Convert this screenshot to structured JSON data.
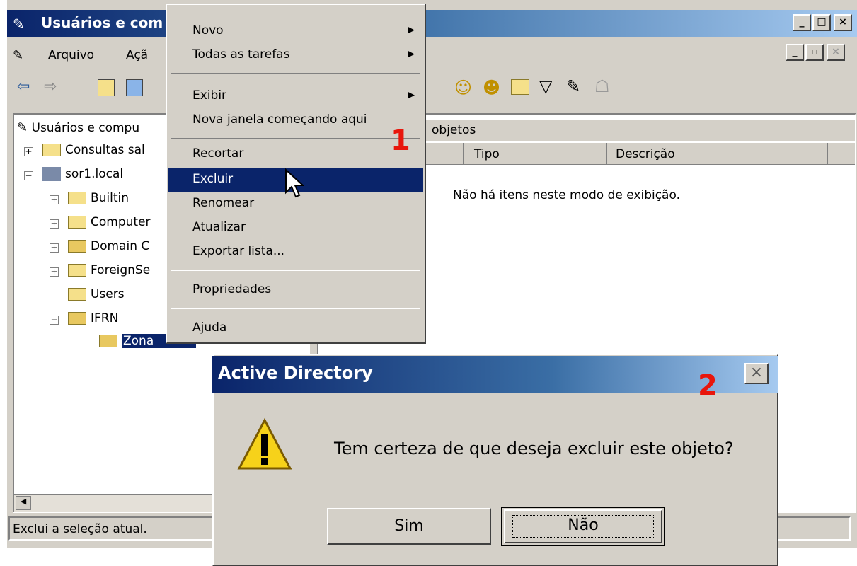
{
  "window": {
    "title": "Usuários e com"
  },
  "menubar": {
    "items": [
      "Arquivo",
      "Açã"
    ]
  },
  "tree": {
    "root": "Usuários e compu",
    "items": [
      "Consultas sal",
      "sor1.local",
      "Builtin",
      "Computer",
      "Domain C",
      "ForeignSe",
      "Users",
      "IFRN",
      "Zona"
    ]
  },
  "right_pane": {
    "header_text": "objetos",
    "columns": [
      "Tipo",
      "Descrição"
    ],
    "empty_message": "Não há itens neste modo de exibição."
  },
  "context_menu": {
    "items": {
      "novo": "Novo",
      "todas": "Todas as tarefas",
      "exibir": "Exibir",
      "nova_janela": "Nova janela começando aqui",
      "recortar": "Recortar",
      "excluir": "Excluir",
      "renomear": "Renomear",
      "atualizar": "Atualizar",
      "exportar": "Exportar lista...",
      "propriedades": "Propriedades",
      "ajuda": "Ajuda"
    },
    "highlighted": "Excluir"
  },
  "status_bar": {
    "text": "Exclui a seleção atual."
  },
  "dialog": {
    "title": "Active Directory",
    "message": "Tem certeza de que deseja excluir este objeto?",
    "yes_label": "Sim",
    "no_label": "Não",
    "close_label": "×"
  },
  "annotations": {
    "step1": "1",
    "step2": "2"
  },
  "colors": {
    "title_blue": "#0a246a",
    "annotation_red": "#e8160c",
    "highlight": "#0a246a"
  }
}
